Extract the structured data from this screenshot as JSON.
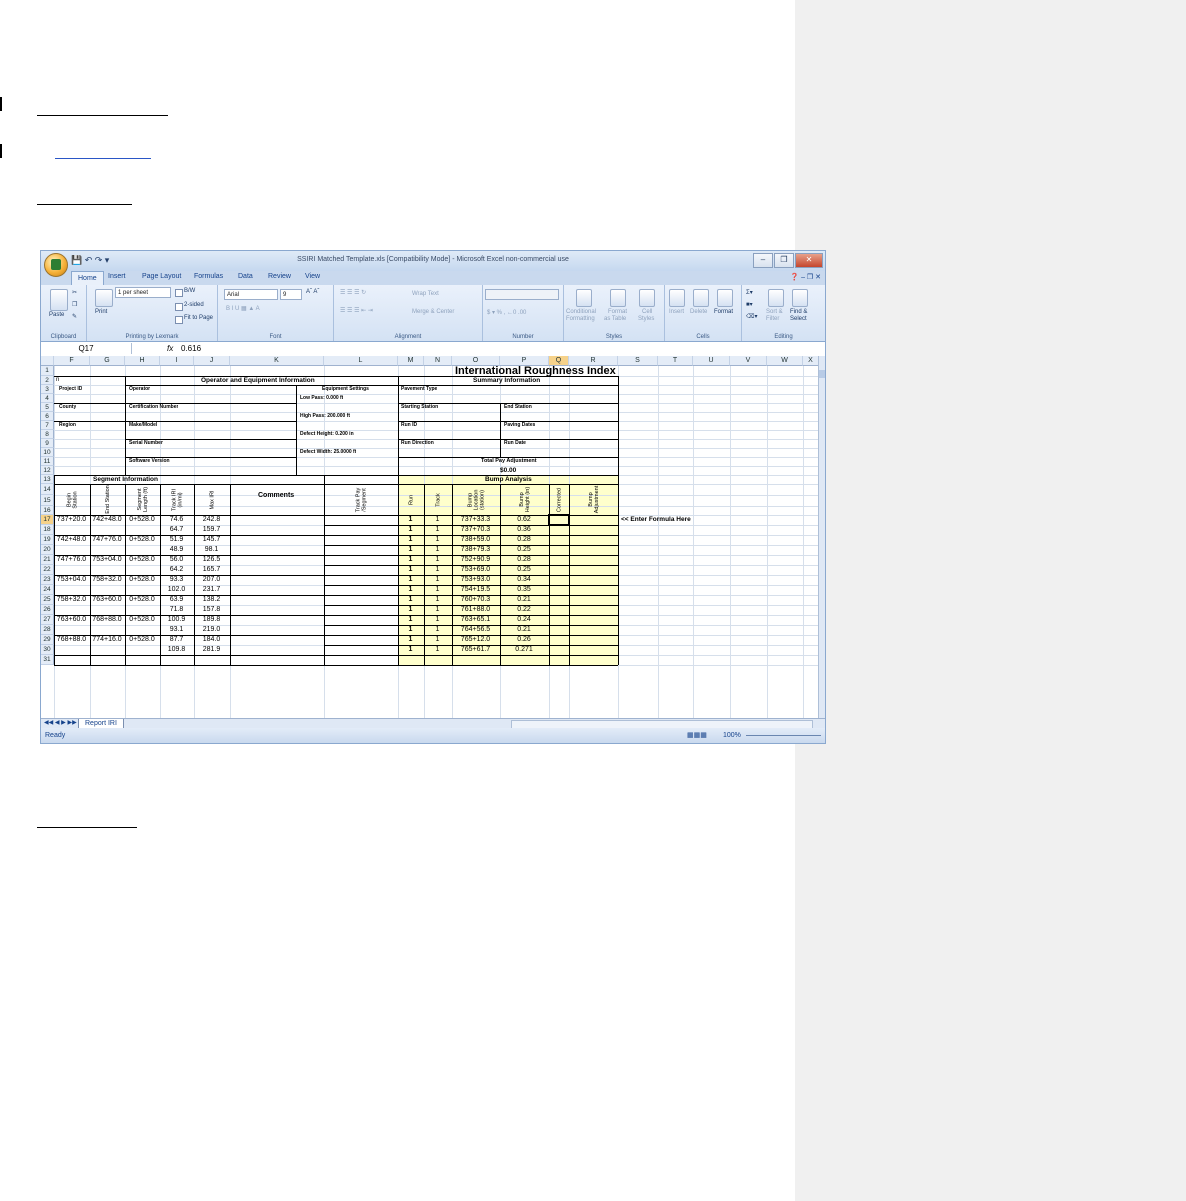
{
  "window": {
    "title": "SSIRI Matched Template.xls  [Compatibility Mode] - Microsoft Excel non-commercial use"
  },
  "ribbon_tabs": [
    "Home",
    "Insert",
    "Page Layout",
    "Formulas",
    "Data",
    "Review",
    "View"
  ],
  "ribbon": {
    "clipboard": {
      "paste": "Paste",
      "label": "Clipboard"
    },
    "printing": {
      "print": "Print",
      "per_sheet": "1 per sheet",
      "bw": "B/W",
      "two_sided": "2-sided",
      "fit": "Fit to Page",
      "label": "Printing by Lexmark"
    },
    "font": {
      "name": "Arial",
      "size": "9",
      "label": "Font"
    },
    "alignment": {
      "wrap": "Wrap Text",
      "merge": "Merge & Center",
      "label": "Alignment"
    },
    "number": {
      "label": "Number"
    },
    "styles": {
      "conditional": "Conditional",
      "conditional2": "Formatting",
      "format_table": "Format",
      "format_table2": "as Table",
      "cell_styles": "Cell",
      "cell_styles2": "Styles",
      "label": "Styles"
    },
    "cells": {
      "insert": "Insert",
      "delete": "Delete",
      "format": "Format",
      "label": "Cells"
    },
    "editing": {
      "sort": "Sort &",
      "sort2": "Filter",
      "find": "Find &",
      "find2": "Select",
      "label": "Editing"
    }
  },
  "formula_bar": {
    "name_box": "Q17",
    "fx": "fx",
    "value": "0.616"
  },
  "columns": [
    "F",
    "G",
    "H",
    "I",
    "J",
    "K",
    "L",
    "M",
    "N",
    "O",
    "P",
    "Q",
    "R",
    "S",
    "T",
    "U",
    "V",
    "W",
    "X"
  ],
  "rows": [
    "1",
    "2",
    "3",
    "4",
    "5",
    "6",
    "7",
    "8",
    "9",
    "10",
    "11",
    "12",
    "13",
    "14",
    "15",
    "16",
    "17",
    "18",
    "19",
    "20",
    "21",
    "22",
    "23",
    "24",
    "25",
    "26",
    "27",
    "28",
    "29",
    "30",
    "31"
  ],
  "sheet": {
    "title": "International Roughness Index",
    "row2_n": "n",
    "op_equip_header": "Operator and Equipment Information",
    "summary_header": "Summary Information",
    "project_id": "Project ID",
    "operator": "Operator",
    "equipment_settings": "Equipment Settings",
    "low_pass": "Low Pass: 0.000 ft",
    "pavement_type": "Pavement Type",
    "county": "County",
    "cert_number": "Certification Number",
    "high_pass": "High Pass: 200.000 ft",
    "starting_station": "Starting Station",
    "end_station": "End Station",
    "region": "Region",
    "make_model": "Make/Model",
    "defect_height": "Defect Height: 0.200 in",
    "run_id": "Run ID",
    "paving_dates": "Paving Dates",
    "serial_number": "Serial Number",
    "defect_width": "Defect Width: 25.0000 ft",
    "run_direction": "Run Direction",
    "run_date": "Run Date",
    "software_version": "Software Version",
    "total_pay": "Total Pay Adjustment",
    "total_pay_value": "$0.00",
    "segment_info": "Segment Information",
    "bump_analysis": "Bump Analysis",
    "hdr_begin": "Begin Station",
    "hdr_end": "End Station",
    "hdr_seglen": "Segment Length (ft)",
    "hdr_track_iri": "Track IRI (in/mi)",
    "hdr_max_iri": "Max IRI",
    "hdr_comments": "Comments",
    "hdr_track_pay": "Track Pay /Segment",
    "hdr_run": "Run",
    "hdr_track": "Track",
    "hdr_bump_loc": "Bump Location (station)",
    "hdr_bump_height": "Bump Height (in)",
    "hdr_corrected": "Corrected",
    "hdr_bump_adj": "Bump Adjustment",
    "enter_formula": "<< Enter Formula Here",
    "data_rows": [
      {
        "row": "17",
        "begin": "737+20.0",
        "end": "742+48.0",
        "len": "0+528.0",
        "iri": "74.6",
        "max": "242.8",
        "run": "1",
        "track": "1",
        "loc": "737+33.3",
        "height": "0.62"
      },
      {
        "row": "18",
        "begin": "",
        "end": "",
        "len": "",
        "iri": "64.7",
        "max": "159.7",
        "run": "1",
        "track": "1",
        "loc": "737+70.3",
        "height": "0.36"
      },
      {
        "row": "19",
        "begin": "742+48.0",
        "end": "747+76.0",
        "len": "0+528.0",
        "iri": "51.9",
        "max": "145.7",
        "run": "1",
        "track": "1",
        "loc": "738+59.0",
        "height": "0.28"
      },
      {
        "row": "20",
        "begin": "",
        "end": "",
        "len": "",
        "iri": "48.9",
        "max": "98.1",
        "run": "1",
        "track": "1",
        "loc": "738+79.3",
        "height": "0.25"
      },
      {
        "row": "21",
        "begin": "747+76.0",
        "end": "753+04.0",
        "len": "0+528.0",
        "iri": "56.0",
        "max": "126.5",
        "run": "1",
        "track": "1",
        "loc": "752+90.9",
        "height": "0.28"
      },
      {
        "row": "22",
        "begin": "",
        "end": "",
        "len": "",
        "iri": "64.2",
        "max": "165.7",
        "run": "1",
        "track": "1",
        "loc": "753+69.0",
        "height": "0.25"
      },
      {
        "row": "23",
        "begin": "753+04.0",
        "end": "758+32.0",
        "len": "0+528.0",
        "iri": "93.3",
        "max": "207.0",
        "run": "1",
        "track": "1",
        "loc": "753+93.0",
        "height": "0.34"
      },
      {
        "row": "24",
        "begin": "",
        "end": "",
        "len": "",
        "iri": "102.0",
        "max": "231.7",
        "run": "1",
        "track": "1",
        "loc": "754+19.5",
        "height": "0.35"
      },
      {
        "row": "25",
        "begin": "758+32.0",
        "end": "763+60.0",
        "len": "0+528.0",
        "iri": "63.9",
        "max": "138.2",
        "run": "1",
        "track": "1",
        "loc": "760+70.3",
        "height": "0.21"
      },
      {
        "row": "26",
        "begin": "",
        "end": "",
        "len": "",
        "iri": "71.8",
        "max": "157.8",
        "run": "1",
        "track": "1",
        "loc": "761+88.0",
        "height": "0.22"
      },
      {
        "row": "27",
        "begin": "763+60.0",
        "end": "768+88.0",
        "len": "0+528.0",
        "iri": "100.9",
        "max": "189.8",
        "run": "1",
        "track": "1",
        "loc": "763+65.1",
        "height": "0.24"
      },
      {
        "row": "28",
        "begin": "",
        "end": "",
        "len": "",
        "iri": "93.1",
        "max": "219.0",
        "run": "1",
        "track": "1",
        "loc": "764+56.5",
        "height": "0.21"
      },
      {
        "row": "29",
        "begin": "768+88.0",
        "end": "774+16.0",
        "len": "0+528.0",
        "iri": "87.7",
        "max": "184.0",
        "run": "1",
        "track": "1",
        "loc": "765+12.0",
        "height": "0.26"
      },
      {
        "row": "30",
        "begin": "",
        "end": "",
        "len": "",
        "iri": "109.8",
        "max": "281.9",
        "run": "1",
        "track": "1",
        "loc": "765+61.7",
        "height": "0.271"
      }
    ]
  },
  "sheet_tab": "Report IRI",
  "status": {
    "ready": "Ready",
    "zoom": "100%"
  }
}
